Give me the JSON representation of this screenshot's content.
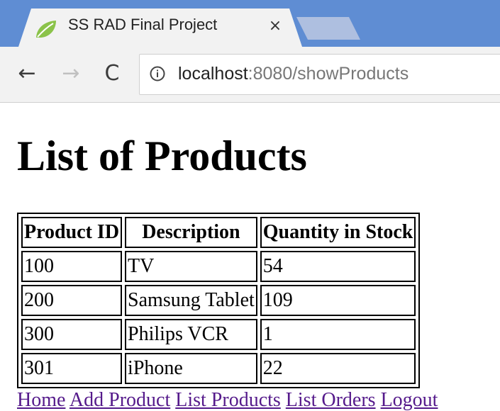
{
  "browser": {
    "tab": {
      "title": "SS RAD Final Project",
      "favicon": "spring-leaf-icon",
      "close_glyph": "×"
    },
    "toolbar": {
      "back_glyph": "←",
      "forward_glyph": "→",
      "reload_glyph": "C",
      "url_host": "localhost",
      "url_rest": ":8080/showProducts"
    },
    "colors": {
      "tabstrip": "#5f8dd3",
      "chrome": "#f2f2f2",
      "visited_link": "#551a8b"
    }
  },
  "page": {
    "title": "List of Products",
    "table": {
      "headers": [
        "Product ID",
        "Description",
        "Quantity in Stock"
      ],
      "rows": [
        [
          "100",
          "TV",
          "54"
        ],
        [
          "200",
          "Samsung Tablet",
          "109"
        ],
        [
          "300",
          "Philips VCR",
          "1"
        ],
        [
          "301",
          "iPhone",
          "22"
        ]
      ]
    },
    "nav_links": [
      "Home",
      "Add Product",
      "List Products",
      "List Orders",
      "Logout"
    ]
  }
}
